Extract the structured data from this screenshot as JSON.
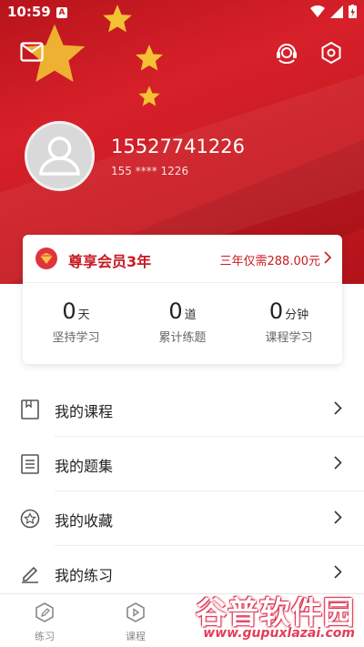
{
  "status_bar": {
    "time": "10:59",
    "notif_icon": "A"
  },
  "profile": {
    "phone": "15527741226",
    "masked_phone": "155 **** 1226"
  },
  "vip": {
    "title": "尊享会员3年",
    "price_text": "三年仅需288.00元"
  },
  "stats": [
    {
      "value": "0",
      "unit": "天",
      "label": "坚持学习"
    },
    {
      "value": "0",
      "unit": "道",
      "label": "累计练题"
    },
    {
      "value": "0",
      "unit": "分钟",
      "label": "课程学习"
    }
  ],
  "menu": [
    {
      "label": "我的课程",
      "icon": "book-icon"
    },
    {
      "label": "我的题集",
      "icon": "document-icon"
    },
    {
      "label": "我的收藏",
      "icon": "star-icon"
    },
    {
      "label": "我的练习",
      "icon": "pencil-icon"
    }
  ],
  "tabs": [
    {
      "label": "练习",
      "icon": "pencil-tab-icon"
    },
    {
      "label": "课程",
      "icon": "play-tab-icon"
    }
  ],
  "watermark": {
    "title": "谷普软件园",
    "url": "www.gupuxlazai.com"
  },
  "colors": {
    "brand_red": "#c81a22",
    "star_gold": "#f2c233"
  }
}
